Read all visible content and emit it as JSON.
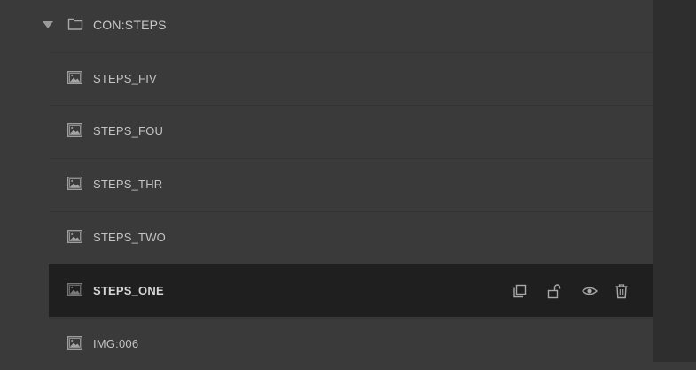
{
  "folder": {
    "label": "CON:STEPS",
    "expanded": true,
    "icon": "folder-icon"
  },
  "layers": [
    {
      "label": "STEPS_FIV",
      "icon": "image-icon",
      "selected": false
    },
    {
      "label": "STEPS_FOU",
      "icon": "image-icon",
      "selected": false
    },
    {
      "label": "STEPS_THR",
      "icon": "image-icon",
      "selected": false
    },
    {
      "label": "STEPS_TWO",
      "icon": "image-icon",
      "selected": false
    },
    {
      "label": "STEPS_ONE",
      "icon": "image-icon",
      "selected": true
    },
    {
      "label": "IMG:006",
      "icon": "image-icon",
      "selected": false
    }
  ],
  "row_actions": [
    "duplicate-icon",
    "unlock-icon",
    "visibility-icon",
    "delete-icon"
  ],
  "colors": {
    "panel_bg": "#3a3a3a",
    "selected_bg": "#1f1f1f",
    "text": "#c4c4c4",
    "icon": "#a0a0a0"
  }
}
